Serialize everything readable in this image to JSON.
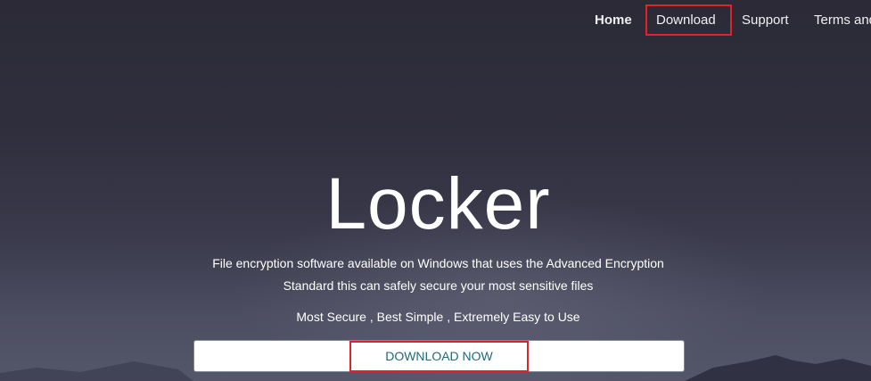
{
  "nav": {
    "items": [
      {
        "label": "Home",
        "active": true
      },
      {
        "label": "Download",
        "highlighted": true
      },
      {
        "label": "Support"
      },
      {
        "label": "Terms and"
      }
    ]
  },
  "hero": {
    "title": "Locker",
    "description_line1": "File encryption software available on Windows that uses the Advanced Encryption",
    "description_line2": "Standard this can safely secure your most sensitive files",
    "tagline": "Most Secure , Best Simple , Extremely Easy to Use",
    "cta_label": "DOWNLOAD NOW"
  },
  "colors": {
    "highlight": "#e0232a",
    "cta_text": "#1f6a78",
    "background": "#302f3e"
  }
}
